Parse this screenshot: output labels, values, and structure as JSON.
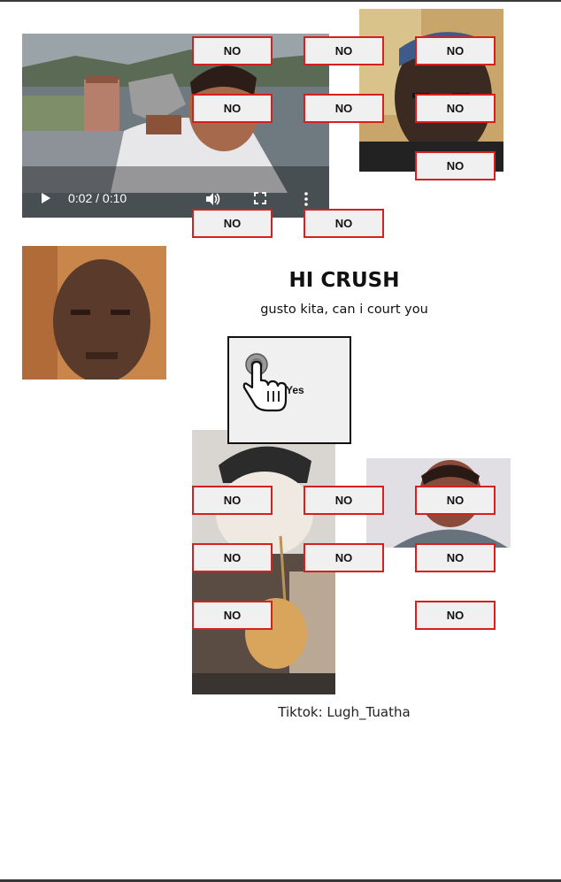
{
  "page": {
    "title": "HI CRUSH",
    "subtitle": "gusto kita, can i court you",
    "yes_label": "Yes",
    "credit": "Tiktok: Lugh_Tuatha"
  },
  "video": {
    "time": "0:02 / 0:10",
    "progress": 0.24,
    "icons": [
      "play-icon",
      "volume-icon",
      "fullscreen-icon",
      "more-options-icon"
    ]
  },
  "no_label": "NO",
  "icons": {
    "cursor": "pointing-hand-cursor-icon"
  },
  "colors": {
    "no_border": "#d61f1f",
    "button_bg": "#f0f0f0",
    "text": "#111111"
  }
}
